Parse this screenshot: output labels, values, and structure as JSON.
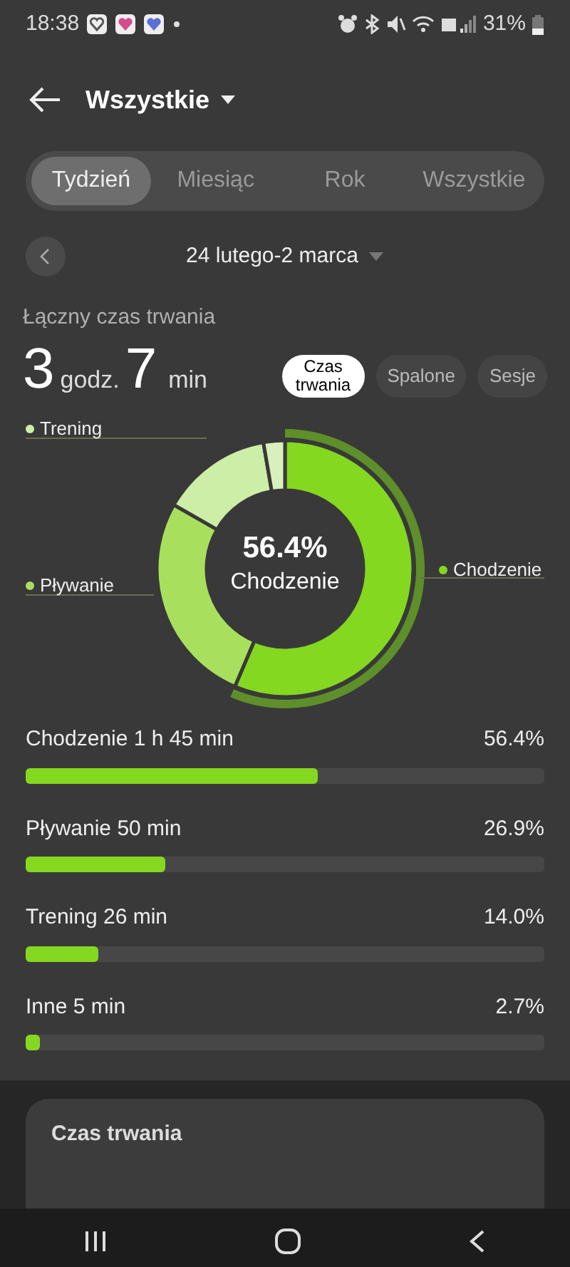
{
  "status_bar": {
    "time": "18:38",
    "battery": "31%"
  },
  "header": {
    "title": "Wszystkie"
  },
  "tabs": [
    {
      "label": "Tydzień",
      "selected": true
    },
    {
      "label": "Miesiąc",
      "selected": false
    },
    {
      "label": "Rok",
      "selected": false
    },
    {
      "label": "Wszystkie",
      "selected": false
    }
  ],
  "date_range": "24 lutego-2 marca",
  "summary": {
    "label": "Łączny czas trwania",
    "hours": "3",
    "hours_unit": "godz.",
    "minutes": "7",
    "minutes_unit": "min"
  },
  "metric_chips": [
    {
      "label": "Czas trwania",
      "selected": true
    },
    {
      "label": "Spalone",
      "selected": false
    },
    {
      "label": "Sesje",
      "selected": false
    }
  ],
  "donut": {
    "center_value": "56.4%",
    "center_label": "Chodzenie",
    "chart_data": {
      "type": "donut",
      "values": [
        56.4,
        26.9,
        14.0,
        2.7
      ],
      "colors": [
        "#84d81f",
        "#a8e05e",
        "#cdeea6",
        "#d8f0bc"
      ],
      "annotations": [
        {
          "text": "Chodzenie"
        },
        {
          "text": "Pływanie"
        },
        {
          "text": "Trening"
        }
      ]
    }
  },
  "activities": [
    {
      "label": "Chodzenie 1 h 45 min",
      "percent": "56.4%",
      "level": 0.564
    },
    {
      "label": "Pływanie 50 min",
      "percent": "26.9%",
      "level": 0.269
    },
    {
      "label": "Trening 26 min",
      "percent": "14.0%",
      "level": 0.14
    },
    {
      "label": "Inne 5 min",
      "percent": "2.7%",
      "level": 0.027
    }
  ],
  "card": {
    "title": "Czas trwania"
  }
}
